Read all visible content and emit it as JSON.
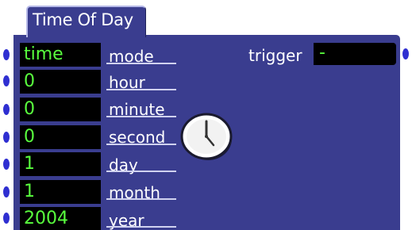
{
  "module": {
    "title": "Time Of Day",
    "trigger": {
      "label": "trigger",
      "value": "-"
    },
    "rows": [
      {
        "id": "mode",
        "value": "time",
        "label": "mode"
      },
      {
        "id": "hour",
        "value": "0",
        "label": "hour"
      },
      {
        "id": "minute",
        "value": "0",
        "label": "minute"
      },
      {
        "id": "second",
        "value": "0",
        "label": "second"
      },
      {
        "id": "day",
        "value": "1",
        "label": "day"
      },
      {
        "id": "month",
        "value": "1",
        "label": "month"
      },
      {
        "id": "year",
        "value": "2004",
        "label": "year"
      }
    ],
    "icon": "clock-icon",
    "colors": {
      "panel": "#3a3d8f",
      "field_bg": "#000000",
      "field_text": "#59ff3e",
      "port": "#2f2fd1"
    }
  }
}
